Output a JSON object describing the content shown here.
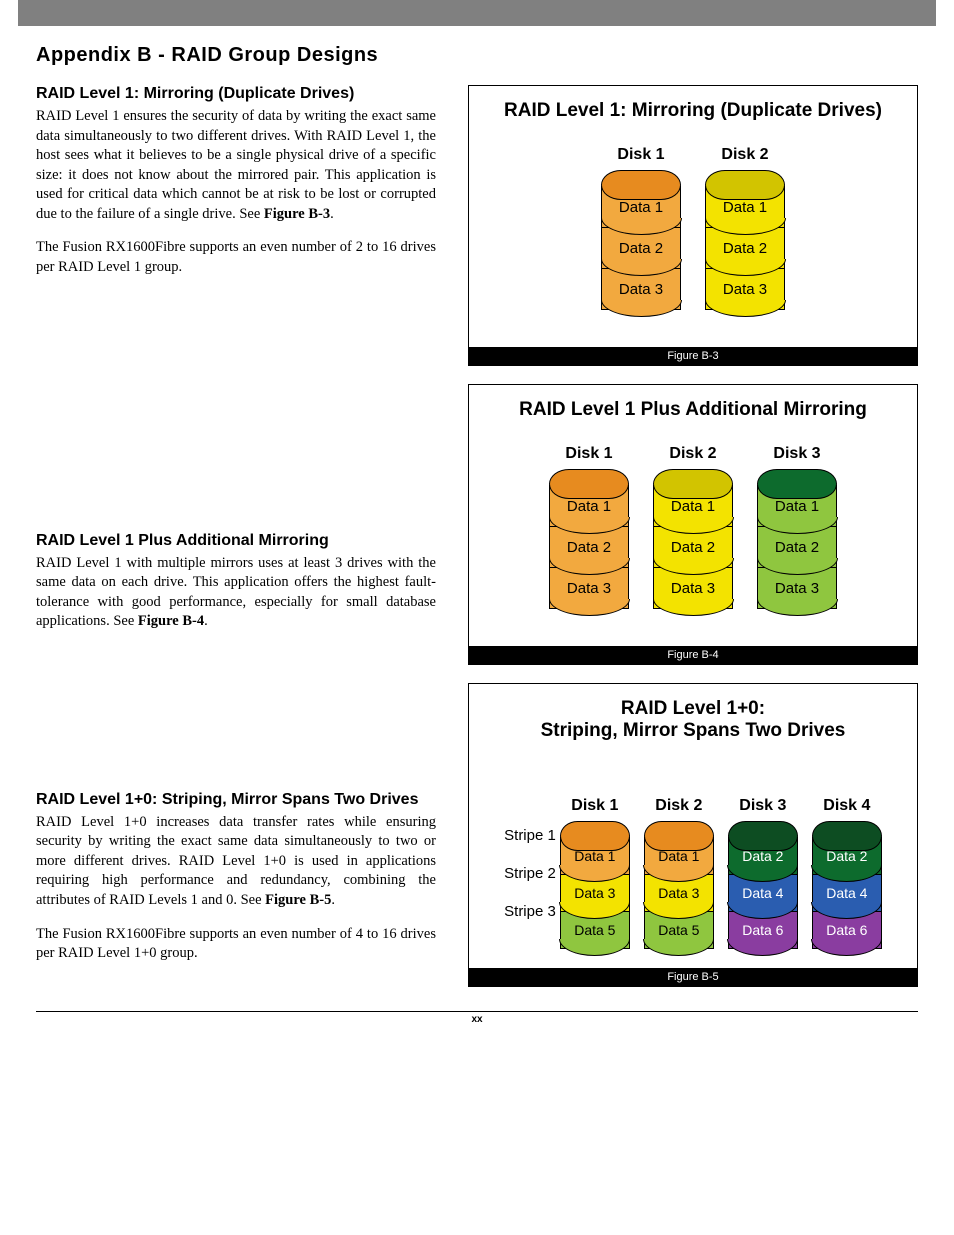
{
  "pageTitle": "Appendix B - RAID Group Designs",
  "pageNum": "xx",
  "sections": [
    {
      "heading": "RAID Level 1: Mirroring (Duplicate Drives)",
      "p1a": "RAID Level 1 ensures the security of data by writing the exact same data simultaneously to two different drives. With RAID Level 1, the host sees what it believes to be a single physical drive of a specific size: it does not know about the mirrored pair. This application is used for critical data which cannot be at risk to be lost or corrupted due to the failure of a single drive. See ",
      "p1b": "Figure B-3",
      "p1c": ".",
      "p2": "The Fusion RX1600Fibre supports an even number of 2 to 16 drives per RAID Level 1 group."
    },
    {
      "heading": "RAID Level 1 Plus Additional Mirroring",
      "p1a": "RAID Level 1 with multiple mirrors uses at least 3 drives with the same data on each drive. This application offers the highest fault-tolerance with good performance, especially for small database applications. See ",
      "p1b": "Figure B-4",
      "p1c": "."
    },
    {
      "heading": "RAID Level 1+0: Striping, Mirror Spans Two Drives",
      "p1a": "RAID Level 1+0 increases data transfer rates while ensuring security by writing the exact same data simultaneously to two or more different drives. RAID Level 1+0 is used in applications requiring high performance and redundancy, combining the attributes of RAID Levels 1 and 0. See ",
      "p1b": "Figure B-5",
      "p1c": ".",
      "p2": "The Fusion RX1600Fibre supports an even number of 4 to 16 drives per RAID Level 1+0 group."
    }
  ],
  "figures": {
    "b3": {
      "title": "RAID Level 1: Mirroring (Duplicate Drives)",
      "caption": "Figure B-3",
      "disks": [
        {
          "label": "Disk 1",
          "cap": "#e78b1f",
          "segs": [
            {
              "t": "Data 1",
              "c": "#f2a93f"
            },
            {
              "t": "Data 2",
              "c": "#f2a93f"
            },
            {
              "t": "Data 3",
              "c": "#f2a93f"
            }
          ]
        },
        {
          "label": "Disk 2",
          "cap": "#d2c400",
          "segs": [
            {
              "t": "Data 1",
              "c": "#f3e300"
            },
            {
              "t": "Data 2",
              "c": "#f3e300"
            },
            {
              "t": "Data 3",
              "c": "#f3e300"
            }
          ]
        }
      ]
    },
    "b4": {
      "title": "RAID Level 1 Plus Additional Mirroring",
      "caption": "Figure B-4",
      "disks": [
        {
          "label": "Disk 1",
          "cap": "#e78b1f",
          "segs": [
            {
              "t": "Data 1",
              "c": "#f2a93f"
            },
            {
              "t": "Data 2",
              "c": "#f2a93f"
            },
            {
              "t": "Data 3",
              "c": "#f2a93f"
            }
          ]
        },
        {
          "label": "Disk 2",
          "cap": "#d2c400",
          "segs": [
            {
              "t": "Data 1",
              "c": "#f3e300"
            },
            {
              "t": "Data 2",
              "c": "#f3e300"
            },
            {
              "t": "Data 3",
              "c": "#f3e300"
            }
          ]
        },
        {
          "label": "Disk 3",
          "cap": "#0d6b2d",
          "segs": [
            {
              "t": "Data 1",
              "c": "#8fc63f"
            },
            {
              "t": "Data 2",
              "c": "#8fc63f"
            },
            {
              "t": "Data 3",
              "c": "#8fc63f"
            }
          ]
        }
      ]
    },
    "b5": {
      "title": "RAID Level 1+0:\nStriping, Mirror Spans Two Drives",
      "caption": "Figure B-5",
      "stripes": [
        "Stripe 1",
        "Stripe 2",
        "Stripe 3"
      ],
      "disks": [
        {
          "label": "Disk 1",
          "cap": "#e78b1f",
          "segs": [
            {
              "t": "Data 1",
              "c": "#f2a93f",
              "tc": "#000"
            },
            {
              "t": "Data 3",
              "c": "#f3e300",
              "tc": "#000"
            },
            {
              "t": "Data 5",
              "c": "#8fc63f",
              "tc": "#000"
            }
          ]
        },
        {
          "label": "Disk 2",
          "cap": "#e78b1f",
          "segs": [
            {
              "t": "Data 1",
              "c": "#f2a93f",
              "tc": "#000"
            },
            {
              "t": "Data 3",
              "c": "#f3e300",
              "tc": "#000"
            },
            {
              "t": "Data 5",
              "c": "#8fc63f",
              "tc": "#000"
            }
          ]
        },
        {
          "label": "Disk 3",
          "cap": "#0d4d22",
          "segs": [
            {
              "t": "Data 2",
              "c": "#0d6b2d",
              "tc": "#fff"
            },
            {
              "t": "Data 4",
              "c": "#2a5db0",
              "tc": "#fff"
            },
            {
              "t": "Data 6",
              "c": "#8a3da0",
              "tc": "#fff"
            }
          ]
        },
        {
          "label": "Disk 4",
          "cap": "#0d4d22",
          "segs": [
            {
              "t": "Data 2",
              "c": "#0d6b2d",
              "tc": "#fff"
            },
            {
              "t": "Data 4",
              "c": "#2a5db0",
              "tc": "#fff"
            },
            {
              "t": "Data 6",
              "c": "#8a3da0",
              "tc": "#fff"
            }
          ]
        }
      ]
    }
  }
}
